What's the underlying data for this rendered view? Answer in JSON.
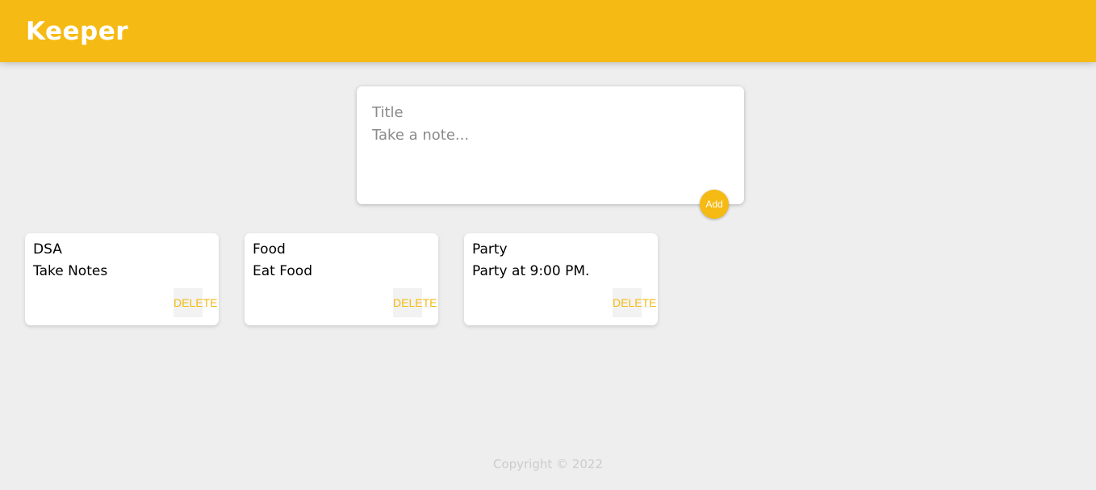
{
  "header": {
    "title": "Keeper"
  },
  "create_note": {
    "title_placeholder": "Title",
    "content_placeholder": "Take a note...",
    "add_label": "Add"
  },
  "notes": [
    {
      "title": "DSA",
      "content": "Take Notes",
      "delete_label": "DELETE"
    },
    {
      "title": "Food",
      "content": "Eat Food",
      "delete_label": "DELETE"
    },
    {
      "title": "Party",
      "content": "Party at 9:00 PM.",
      "delete_label": "DELETE"
    }
  ],
  "footer": {
    "text": "Copyright © 2022"
  },
  "colors": {
    "accent": "#f5ba13",
    "background": "#eeeeee",
    "card": "#ffffff"
  }
}
